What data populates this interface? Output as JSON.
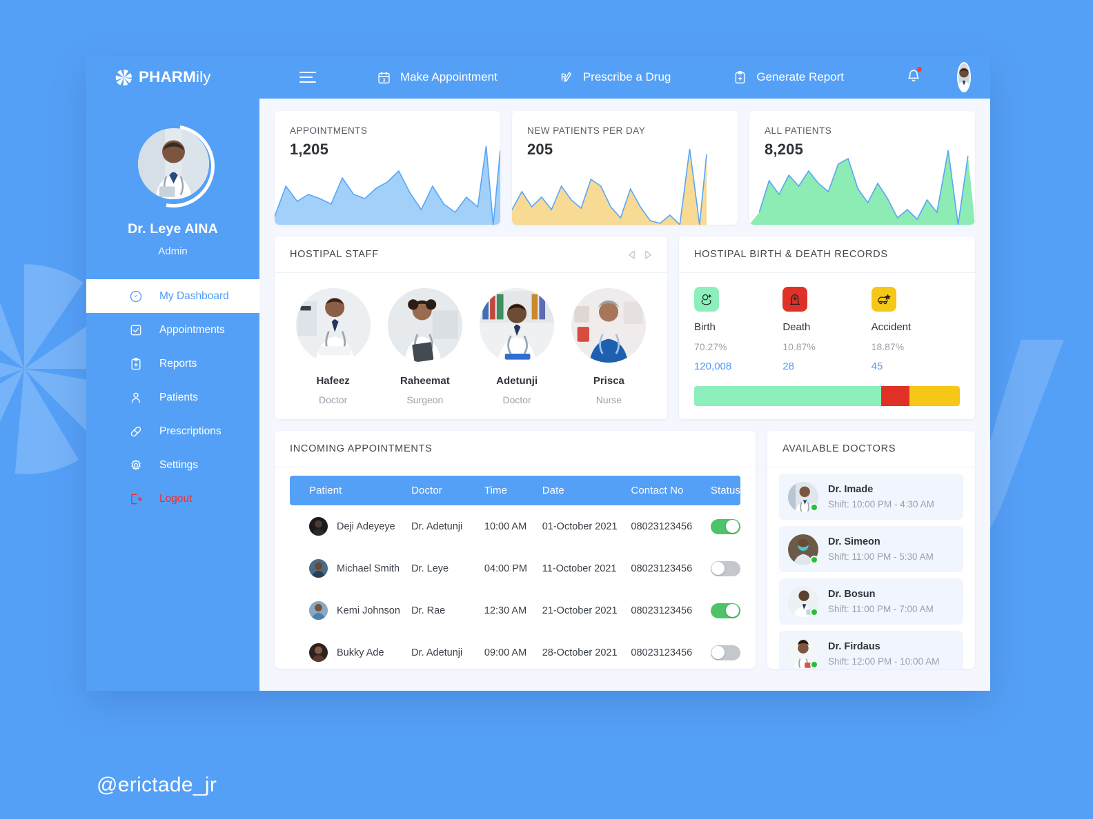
{
  "brand": {
    "name_upper": "PHARM",
    "name_lower": "ily",
    "logo_icon": "burst-logo-icon"
  },
  "watermark": {
    "handle": "@erictade_jr",
    "letter": "y"
  },
  "topbar": {
    "menu_icon": "hamburger-icon",
    "items": [
      {
        "label": "Make Appointment",
        "icon": "calendar-icon"
      },
      {
        "label": "Prescribe a Drug",
        "icon": "prescription-pen-icon"
      },
      {
        "label": "Generate Report",
        "icon": "clipboard-plus-icon"
      }
    ],
    "notification_icon": "bell-icon",
    "has_notification": true,
    "avatar": "user-avatar"
  },
  "sidebar": {
    "profile": {
      "name": "Dr. Leye AINA",
      "role": "Admin",
      "avatar": "profile-avatar"
    },
    "items": [
      {
        "label": "My Dashboard",
        "icon": "dashboard-icon",
        "active": true
      },
      {
        "label": "Appointments",
        "icon": "checkbox-icon",
        "active": false
      },
      {
        "label": "Reports",
        "icon": "clipboard-plus-icon",
        "active": false
      },
      {
        "label": "Patients",
        "icon": "user-icon",
        "active": false
      },
      {
        "label": "Prescriptions",
        "icon": "pill-icon",
        "active": false
      }
    ],
    "bottom_items": [
      {
        "label": "Settings",
        "icon": "gear-icon"
      },
      {
        "label": "Logout",
        "icon": "logout-icon"
      }
    ]
  },
  "stats": [
    {
      "title": "APPOINTMENTS",
      "value": "1,205",
      "color": "#a2d0f9",
      "stroke": "#5aa6f6"
    },
    {
      "title": "NEW PATIENTS PER DAY",
      "value": "205",
      "color": "#f7db95",
      "stroke": "#5aa6f6"
    },
    {
      "title": "ALL PATIENTS",
      "value": "8,205",
      "color": "#8debb4",
      "stroke": "#5aa6f6"
    }
  ],
  "chart_data": [
    {
      "type": "area",
      "title": "APPOINTMENTS",
      "values": [
        10,
        52,
        28,
        40,
        33,
        26,
        60,
        40,
        35,
        47,
        55,
        70,
        40,
        18,
        46,
        26,
        14,
        36,
        28,
        100,
        96
      ],
      "ylim": [
        0,
        100
      ],
      "grid": false,
      "legend": "none",
      "xlabel": "",
      "ylabel": ""
    },
    {
      "type": "area",
      "title": "NEW PATIENTS PER DAY",
      "values": [
        18,
        40,
        22,
        34,
        20,
        46,
        30,
        24,
        16,
        54,
        46,
        22,
        10,
        38,
        18,
        8,
        4,
        12,
        2,
        92,
        84
      ],
      "ylim": [
        0,
        100
      ],
      "grid": false,
      "legend": "none",
      "xlabel": "",
      "ylabel": ""
    },
    {
      "type": "area",
      "title": "ALL PATIENTS",
      "values": [
        14,
        56,
        40,
        62,
        48,
        66,
        50,
        44,
        72,
        80,
        50,
        34,
        52,
        36,
        12,
        20,
        10,
        28,
        18,
        96,
        86
      ],
      "ylim": [
        0,
        100
      ],
      "grid": false,
      "legend": "none",
      "xlabel": "",
      "ylabel": ""
    }
  ],
  "staff": {
    "title": "HOSTIPAL STAFF",
    "prev_icon": "chevron-left-icon",
    "next_icon": "chevron-right-icon",
    "members": [
      {
        "name": "Hafeez",
        "role": "Doctor"
      },
      {
        "name": "Raheemat",
        "role": "Surgeon"
      },
      {
        "name": "Adetunji",
        "role": "Doctor"
      },
      {
        "name": "Prisca",
        "role": "Nurse"
      }
    ]
  },
  "records": {
    "title": "HOSTIPAL BIRTH & DEATH RECORDS",
    "items": [
      {
        "label": "Birth",
        "percent": "70.27%",
        "count": "120,008",
        "color": "#8cefbb",
        "icon": "baby-icon",
        "share": 70.27
      },
      {
        "label": "Death",
        "percent": "10.87%",
        "count": "28",
        "color": "#e03127",
        "icon": "tombstone-icon",
        "share": 10.87
      },
      {
        "label": "Accident",
        "percent": "18.87%",
        "count": "45",
        "color": "#f7c717",
        "icon": "car-crash-icon",
        "share": 18.87
      }
    ]
  },
  "appointments": {
    "title": "INCOMING APPOINTMENTS",
    "columns": [
      "Patient",
      "Doctor",
      "Time",
      "Date",
      "Contact No",
      "Status"
    ],
    "rows": [
      {
        "patient": "Deji Adeyeye",
        "doctor": "Dr. Adetunji",
        "time": "10:00 AM",
        "date": "01-October 2021",
        "contact": "08023123456",
        "status": true
      },
      {
        "patient": "Michael Smith",
        "doctor": "Dr. Leye",
        "time": "04:00 PM",
        "date": "11-October 2021",
        "contact": "08023123456",
        "status": false
      },
      {
        "patient": "Kemi Johnson",
        "doctor": "Dr. Rae",
        "time": "12:30 AM",
        "date": "21-October 2021",
        "contact": "08023123456",
        "status": true
      },
      {
        "patient": "Bukky Ade",
        "doctor": "Dr. Adetunji",
        "time": "09:00 AM",
        "date": "28-October 2021",
        "contact": "08023123456",
        "status": false
      }
    ]
  },
  "available_doctors": {
    "title": "AVAILABLE DOCTORS",
    "items": [
      {
        "name": "Dr. Imade",
        "shift": "Shift: 10:00 PM - 4:30 AM",
        "online": true
      },
      {
        "name": "Dr. Simeon",
        "shift": "Shift: 11:00 PM - 5:30 AM",
        "online": true
      },
      {
        "name": "Dr. Bosun",
        "shift": "Shift: 11:00 PM - 7:00 AM",
        "online": true
      },
      {
        "name": "Dr. Firdaus",
        "shift": "Shift: 12:00 PM - 10:00 AM",
        "online": true
      }
    ]
  },
  "colors": {
    "brand_blue": "#55a0f7",
    "accent_blue": "#4f9bf5",
    "green": "#4ec36a",
    "red": "#ef2d2d",
    "yellow": "#f7c717"
  }
}
